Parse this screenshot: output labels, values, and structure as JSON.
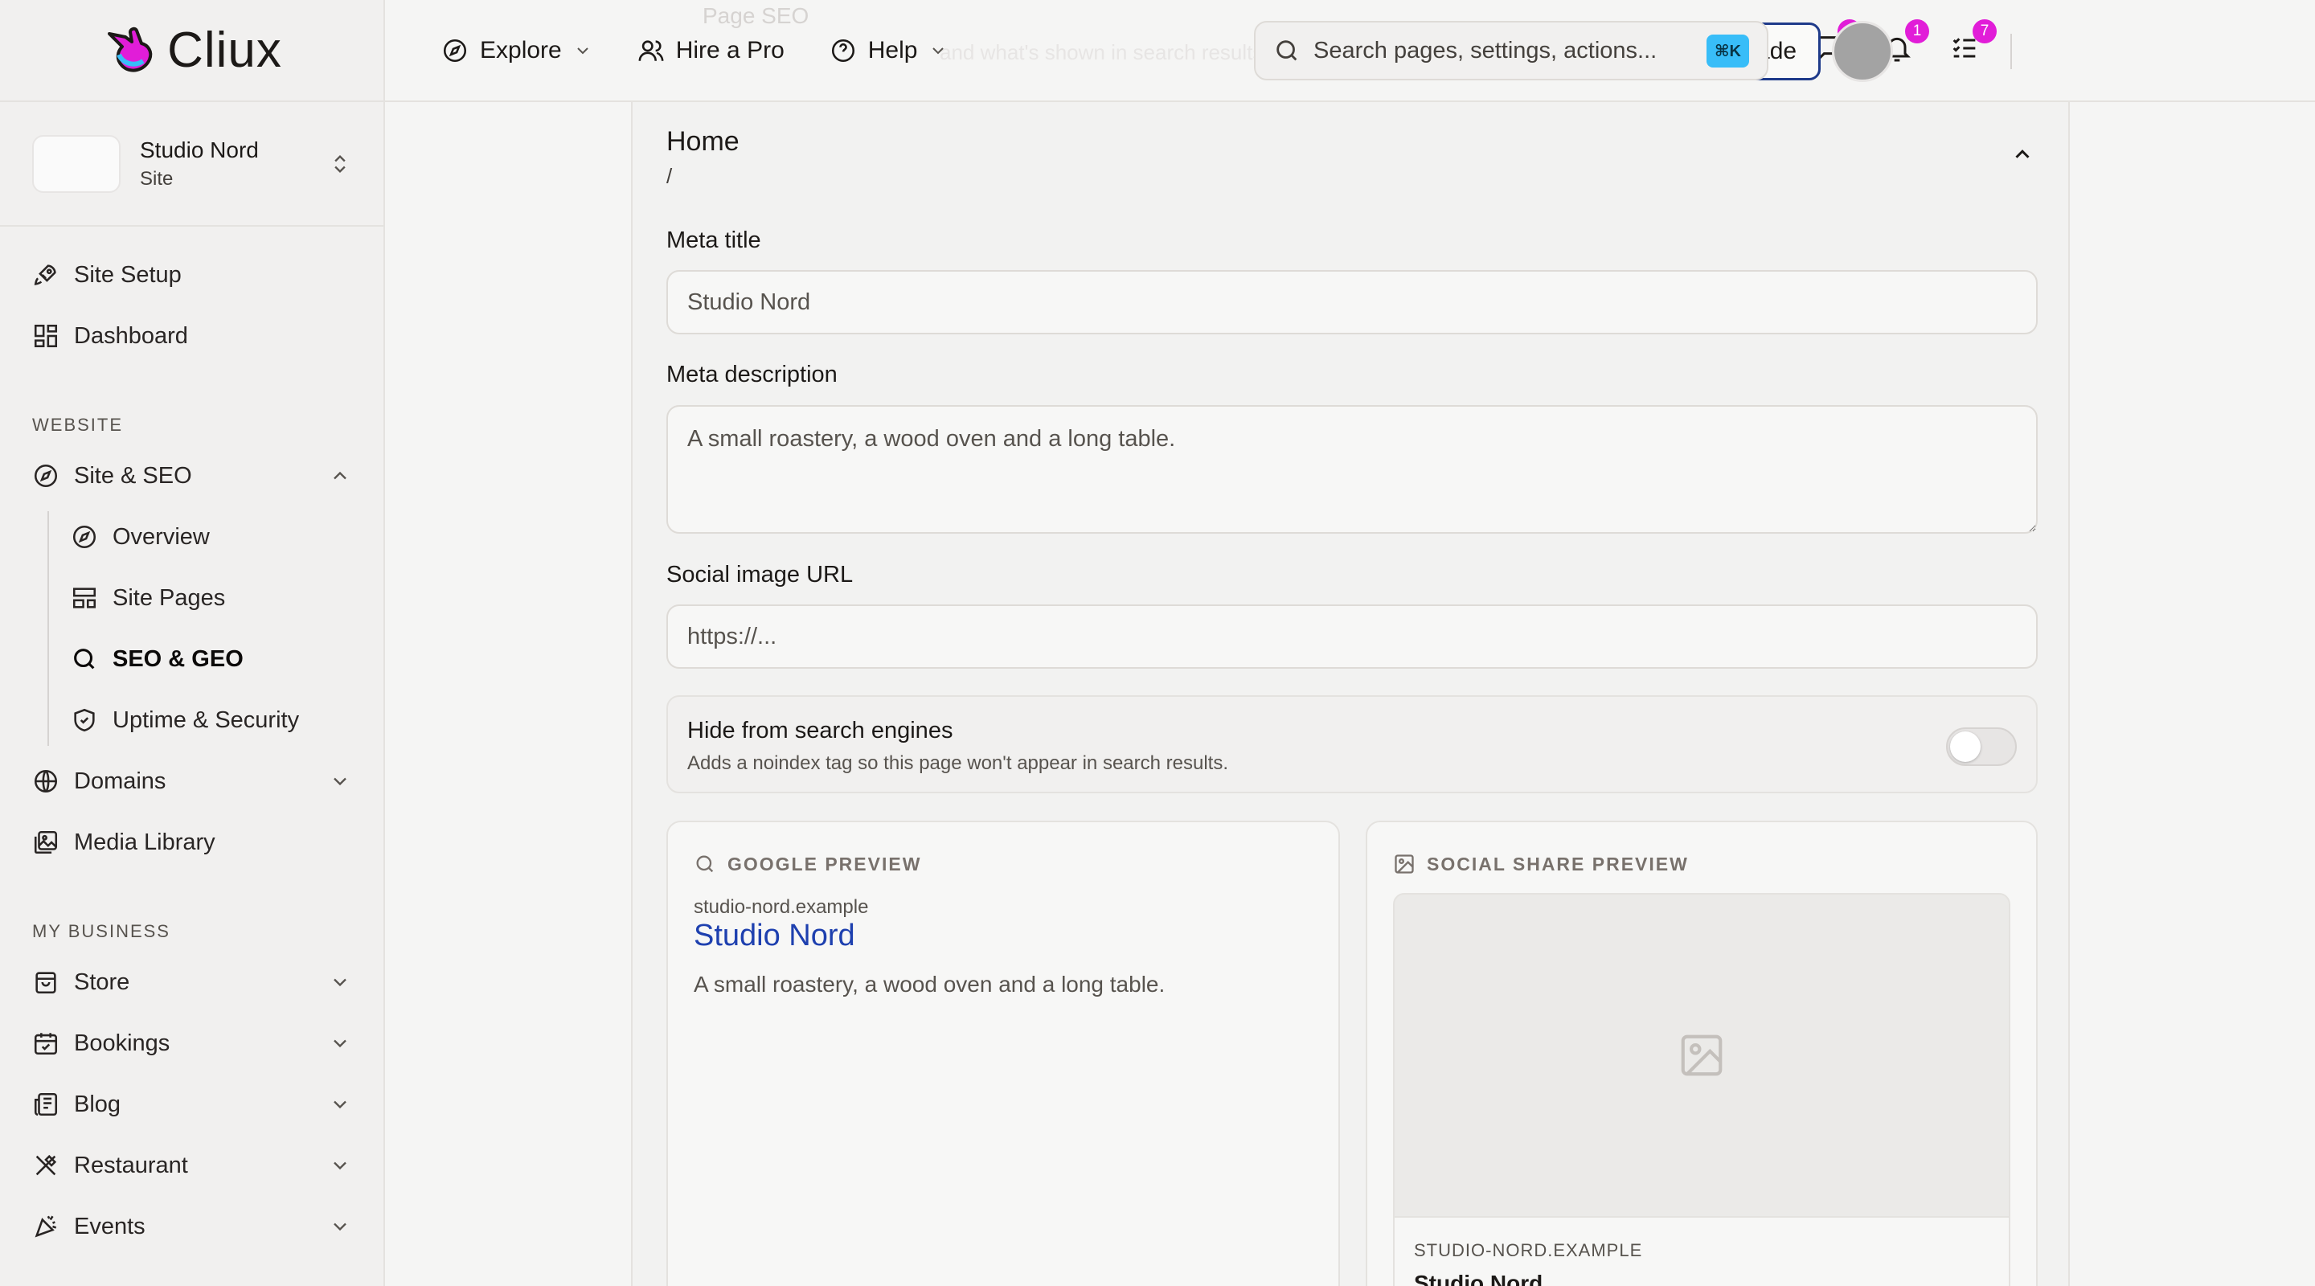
{
  "app": {
    "logo_text": "Cliux"
  },
  "site_switcher": {
    "name": "Studio Nord",
    "type": "Site"
  },
  "sidebar": {
    "top_items": [
      {
        "label": "Site Setup",
        "icon": "rocket-icon"
      },
      {
        "label": "Dashboard",
        "icon": "dashboard-icon"
      }
    ],
    "section_website": "WEBSITE",
    "site_seo": {
      "label": "Site & SEO",
      "expanded": true,
      "children": [
        {
          "label": "Overview",
          "icon": "compass-icon"
        },
        {
          "label": "Site Pages",
          "icon": "layout-icon"
        },
        {
          "label": "SEO & GEO",
          "icon": "search-icon",
          "active": true
        },
        {
          "label": "Uptime & Security",
          "icon": "shield-icon"
        }
      ]
    },
    "website_items": [
      {
        "label": "Domains",
        "icon": "globe-icon"
      },
      {
        "label": "Media Library",
        "icon": "media-icon"
      }
    ],
    "section_business": "MY BUSINESS",
    "business_items": [
      {
        "label": "Store",
        "icon": "bag-icon"
      },
      {
        "label": "Bookings",
        "icon": "calendar-icon"
      },
      {
        "label": "Blog",
        "icon": "newspaper-icon"
      },
      {
        "label": "Restaurant",
        "icon": "utensils-icon"
      },
      {
        "label": "Events",
        "icon": "party-icon"
      }
    ]
  },
  "topbar": {
    "ghost_title": "Page SEO",
    "ghost_subtitle": "and what's shown in search results",
    "explore_label": "Explore",
    "hire_label": "Hire a Pro",
    "help_label": "Help",
    "search_placeholder": "Search pages, settings, actions...",
    "search_shortcut": "⌘K",
    "messages_count": "1",
    "notifications_count": "1",
    "tasks_count": "7",
    "upgrade_label": "Upgrade"
  },
  "page": {
    "title": "Home",
    "path": "/",
    "meta_title_label": "Meta title",
    "meta_title_value": "",
    "meta_title_placeholder": "Studio Nord",
    "meta_desc_label": "Meta description",
    "meta_desc_value": "",
    "meta_desc_placeholder": "A small roastery, a wood oven and a long table.",
    "social_image_label": "Social image URL",
    "social_image_value": "",
    "social_image_placeholder": "https://...",
    "hide_title": "Hide from search engines",
    "hide_desc": "Adds a noindex tag so this page won't appear in search results.",
    "hide_enabled": false
  },
  "google_preview": {
    "heading": "GOOGLE PREVIEW",
    "url": "studio-nord.example",
    "title": "Studio Nord",
    "description": "A small roastery, a wood oven and a long table."
  },
  "social_preview": {
    "heading": "SOCIAL SHARE PREVIEW",
    "url": "STUDIO-NORD.EXAMPLE",
    "title": "Studio Nord"
  },
  "colors": {
    "accent": "#38bdf8",
    "badge": "#e11dd8",
    "link": "#1e40af",
    "upgrade_border": "#1e3a8a"
  }
}
